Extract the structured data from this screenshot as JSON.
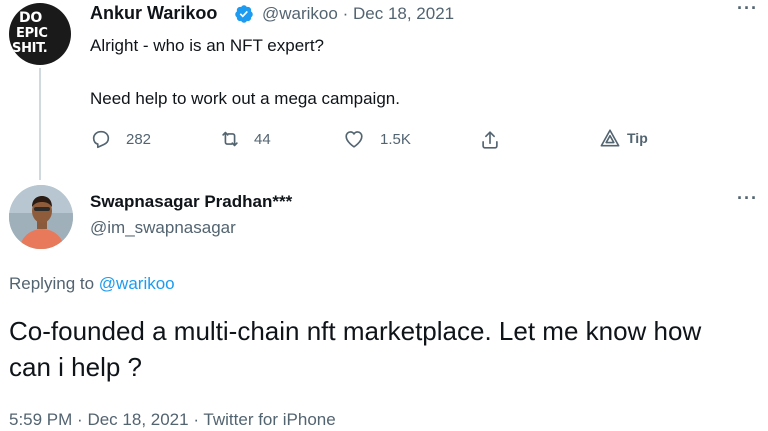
{
  "parent_tweet": {
    "avatar_text": [
      "DO",
      "EPIC",
      "SHIT."
    ],
    "author_name": "Ankur Warikoo",
    "handle": "@warikoo",
    "separator": "·",
    "date": "Dec 18, 2021",
    "text_line1": "Alright - who is an NFT expert?",
    "text_line2": "Need help to work out a mega campaign.",
    "stats": {
      "replies": "282",
      "retweets": "44",
      "likes": "1.5K",
      "tip_label": "Tip"
    }
  },
  "reply_tweet": {
    "author_name": "Swapnasagar Pradhan***",
    "handle": "@im_swapnasagar",
    "replying_prefix": "Replying to",
    "replying_to": "@warikoo",
    "text": "Co-founded a multi-chain nft marketplace. Let me know how can i help ?",
    "time": "5:59 PM",
    "separator": "·",
    "date": "Dec 18, 2021",
    "source": "Twitter for iPhone"
  },
  "colors": {
    "accent": "#1d9bf0",
    "secondary_text": "#536471",
    "primary_text": "#0f1419",
    "thread_line": "#cfd9de"
  }
}
